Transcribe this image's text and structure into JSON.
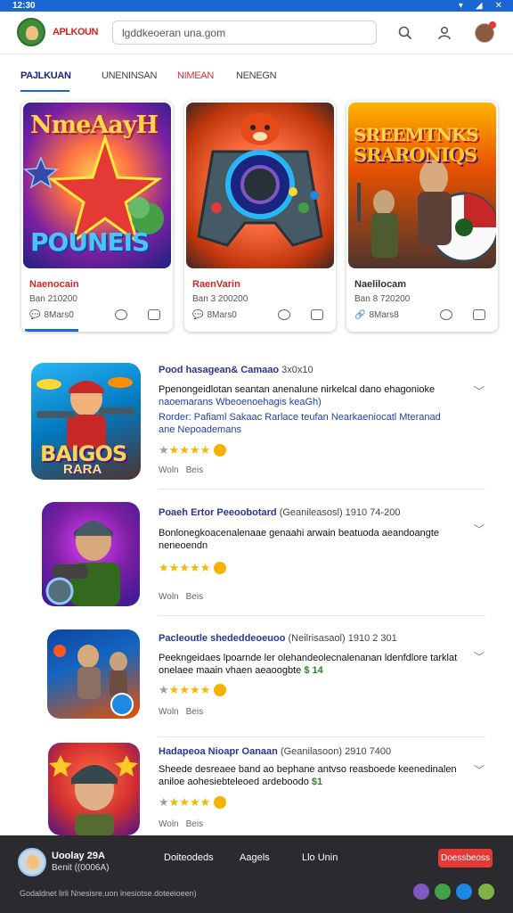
{
  "statusbar": {
    "time": "12:30"
  },
  "header": {
    "app_name": "APLKOUN",
    "search_value": "lgddkeoeran una.gom",
    "icons": [
      "search-icon",
      "profile-icon",
      "avatar"
    ]
  },
  "tabs": [
    {
      "label": "PAJLKUAN",
      "active": true
    },
    {
      "label": "UNENINSAN",
      "active": false
    },
    {
      "label": "NIMEAN",
      "active": false
    },
    {
      "label": "NENEGN",
      "active": false
    }
  ],
  "featured": [
    {
      "art_title": "NmeAayH",
      "art_sub": "POUNEIS",
      "title": "Naenocain",
      "sub": "Ban 210200",
      "meta": "8Mars0"
    },
    {
      "art_title": "",
      "art_sub": "",
      "title": "RaenVarin",
      "sub": "Ban 3 200200",
      "meta": "8Mars0"
    },
    {
      "art_title": "SREEMTNKS",
      "art_sub": "SRARONIQS",
      "title": "Naelilocam",
      "sub": "Ban 8 720200",
      "meta": "8Mars8"
    }
  ],
  "list": [
    {
      "title": "Pood hasagean& Camaao",
      "extra": "3x0x10",
      "desc1": "Ppenongeidlotan seantan anenalune nirkelcal dano ehagonioke",
      "desc2": "naoemarans Wbeoenoehagis keaGh)",
      "desc3": "Rorder: Pafiaml Sakaac Rarlace teufan Nearkaeniocatl Mteranad",
      "desc4": "ane Nepoademans",
      "stars": 4,
      "rating_label": "Woln",
      "rating_count": "Beis"
    },
    {
      "title": "Poaeh Ertor Peeoobotard",
      "extra": "(Geanileasosl) 1910 74-200",
      "desc1": "Bonlonegkoacenalenaae genaahi arwain beatuoda aeandoangte",
      "desc2": "neneoendn",
      "stars": 4,
      "rating_label": "Woln",
      "rating_count": "Beis"
    },
    {
      "title": "Pacleoutle shededdeoeuoo",
      "extra": "(Neilrisasaol) 1910 2 301",
      "desc1": "Peekngeidaes lpoarnde ler olehandeolecnalenanan ldenfdlore tarklat",
      "desc2": "onelaee maain vhaen aeaoogbte",
      "price": "$ 14",
      "stars": 4,
      "rating_label": "Woln",
      "rating_count": "Beis"
    },
    {
      "title": "Hadapeoa Nioapr Oanaan",
      "extra": "(Geanilasoon) 2910 7400",
      "desc1": "Sheede desreaee band ao bephane antvso reasboede keenedinalen",
      "desc2": "aniloe aohesiebteleoed ardeboodo",
      "price": "$1",
      "stars": 4,
      "rating_label": "Woln",
      "rating_count": "Beis"
    }
  ],
  "bottombar": {
    "user": "Uoolay 29A",
    "user_sub": "Benit ((0006A)",
    "links": [
      "Doiteodeds",
      "Aagels",
      "Llo Unin"
    ],
    "button": "Doessbeoss",
    "footer": "Godaldnet lirli Nnesisre.uon lnesiotse.doteeioeen)",
    "social_colors": [
      "#7e57c2",
      "#43a047",
      "#1e88e5",
      "#7cb342"
    ]
  },
  "colors": {
    "accent": "#1a66d2",
    "brand_red": "#d62020",
    "star": "#f5b800",
    "bottom_bg": "#2b2b2f"
  }
}
